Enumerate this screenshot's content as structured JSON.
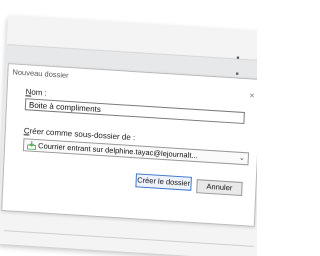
{
  "background": {
    "bullets": [
      "▪",
      "▪"
    ]
  },
  "dialog": {
    "title": "Nouveau dossier",
    "close_label": "×",
    "name_label_accel": "N",
    "name_label_rest": "om :",
    "name_value": "Boite à compliments",
    "parent_label_accel": "C",
    "parent_label_rest": "réer comme sous-dossier de :",
    "parent_value": "Courrier entrant sur delphine.tayac@lejournalt...",
    "chevron": "⌄",
    "create_button": "Créer le dossier",
    "cancel_button": "Annuler"
  },
  "icons": {
    "inbox": "inbox-download-icon",
    "close": "close-icon",
    "chevron": "chevron-down-icon"
  },
  "colors": {
    "accent_border": "#3c78c8",
    "inbox_icon": "#4caf50"
  }
}
